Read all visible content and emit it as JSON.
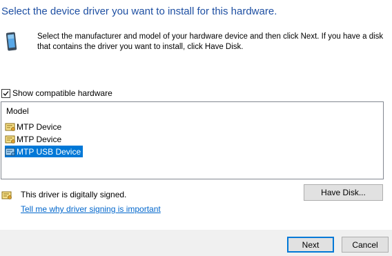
{
  "header": {
    "title": "Select the device driver you want to install for this hardware.",
    "description": "Select the manufacturer and model of your hardware device and then click Next. If you have a disk that contains the driver you want to install, click Have Disk."
  },
  "options": {
    "show_compatible_label": "Show compatible hardware",
    "show_compatible_checked": true
  },
  "model_list": {
    "header": "Model",
    "items": [
      {
        "label": "MTP Device",
        "selected": false
      },
      {
        "label": "MTP Device",
        "selected": false
      },
      {
        "label": "MTP USB Device",
        "selected": true
      }
    ]
  },
  "signing": {
    "status_text": "This driver is digitally signed.",
    "link_text": "Tell me why driver signing is important"
  },
  "buttons": {
    "have_disk": "Have Disk...",
    "next": "Next",
    "cancel": "Cancel"
  },
  "colors": {
    "heading": "#1e4fa2",
    "selection": "#0078d7",
    "link": "#0066cc",
    "footer": "#f0f0f0"
  },
  "icons": {
    "hardware": "phone-device-icon",
    "driver": "driver-certificate-icon",
    "signed": "signed-certificate-icon"
  }
}
